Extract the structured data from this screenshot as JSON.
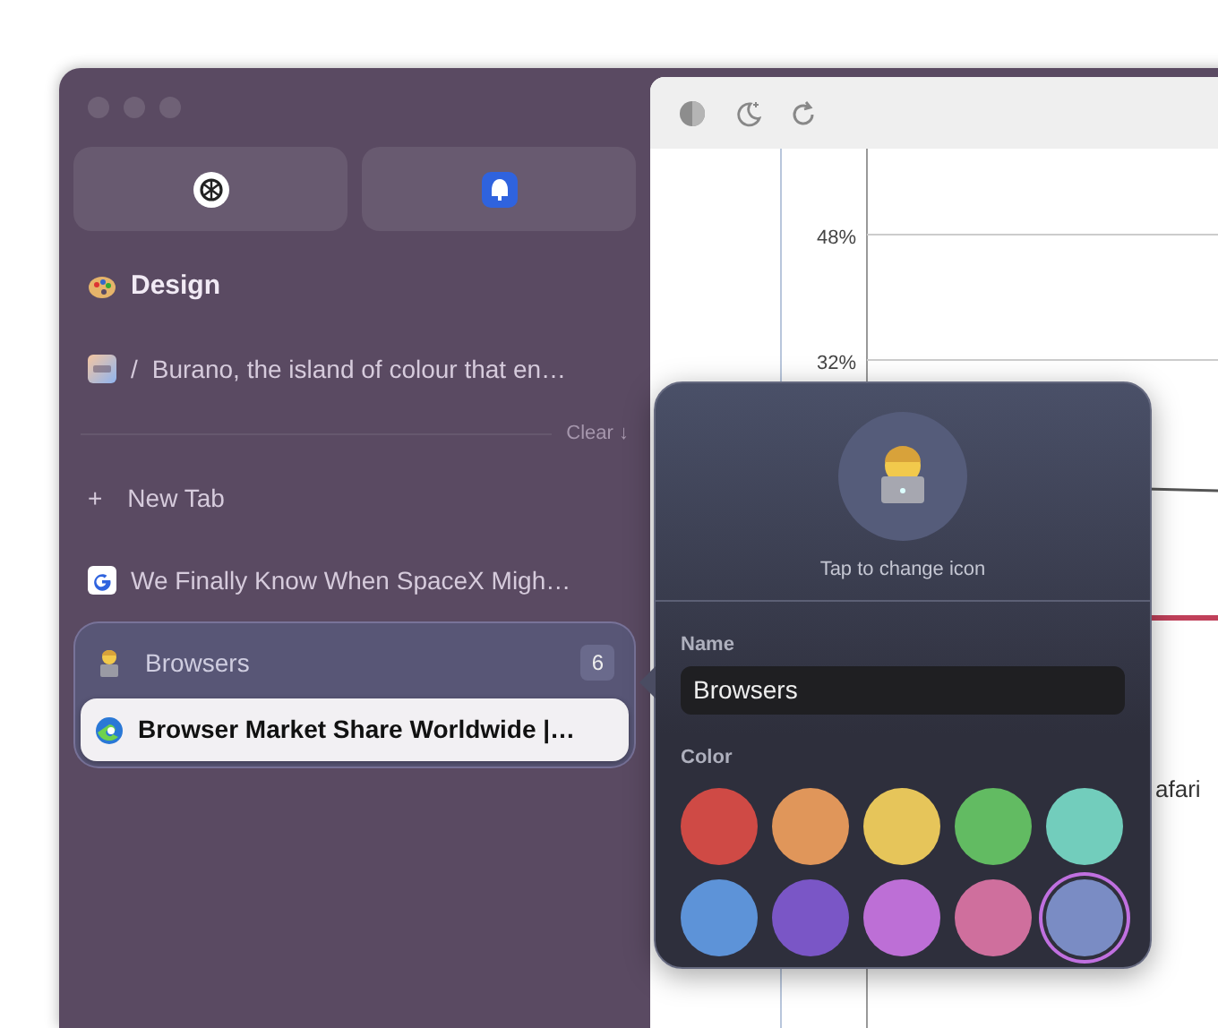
{
  "sidebar": {
    "pinned": [
      {
        "kind": "knot",
        "selected": false
      },
      {
        "kind": "arc",
        "selected": false
      }
    ],
    "folder": {
      "label": "Design"
    },
    "tabs": [
      {
        "kind": "cc",
        "prefix": "/",
        "title": "Burano, the island of colour that en…",
        "selected": false
      }
    ],
    "clear": "Clear ↓",
    "new_tab": {
      "icon": "+",
      "label": "New Tab"
    },
    "today_tabs": [
      {
        "kind": "google",
        "title": "We Finally Know When SpaceX Migh…",
        "selected": false
      }
    ],
    "group": {
      "name": "Browsers",
      "count": "6",
      "tabs": [
        {
          "kind": "edge",
          "title": "Browser Market Share Worldwide |…",
          "selected": true
        }
      ]
    }
  },
  "page": {
    "axis_labels": [
      "48%",
      "32%"
    ],
    "legend_label": "afari"
  },
  "popover": {
    "caption": "Tap to change icon",
    "name_label": "Name",
    "name_value": "Browsers",
    "color_label": "Color",
    "colors": [
      {
        "color": "#cf4a45",
        "selected": false
      },
      {
        "color": "#e0965a",
        "selected": false
      },
      {
        "color": "#e6c55a",
        "selected": false
      },
      {
        "color": "#62bb62",
        "selected": false
      },
      {
        "color": "#72cdbc",
        "selected": false
      },
      {
        "color": "#5d93d8",
        "selected": false
      },
      {
        "color": "#7a56c6",
        "selected": false
      },
      {
        "color": "#bd6fd6",
        "selected": false
      },
      {
        "color": "#cf6f9d",
        "selected": false
      },
      {
        "color": "#7a8cc4",
        "selected": true
      }
    ]
  }
}
